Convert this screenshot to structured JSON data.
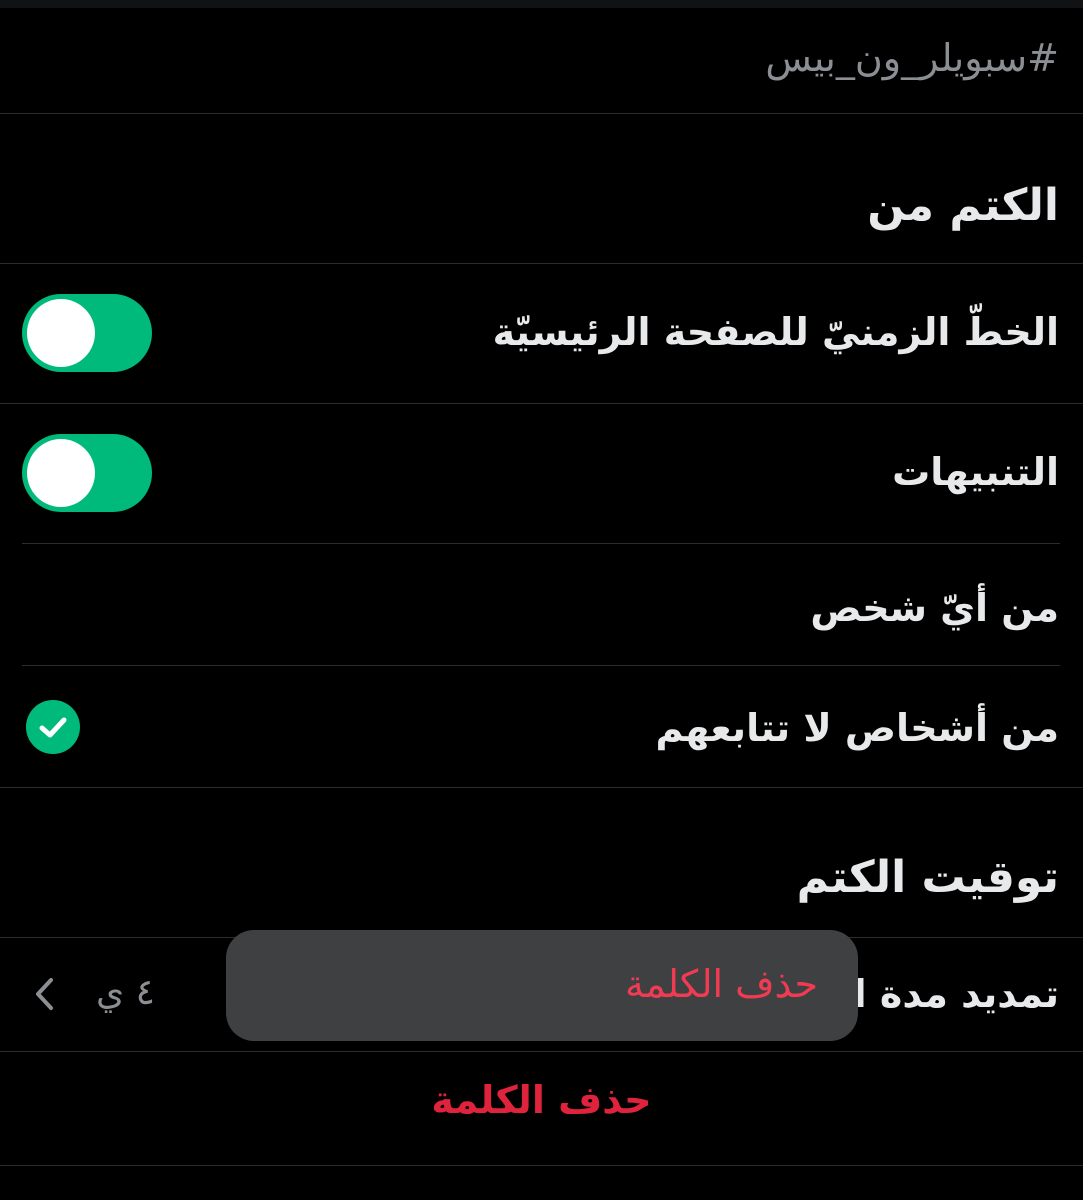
{
  "keyword": "#سبويلر_ون_بيس",
  "mute_from": {
    "title": "الكتم من",
    "home_timeline_label": "الخطّ الزمنيّ للصفحة الرئيسيّة",
    "home_timeline_on": true,
    "notifications_label": "التنبيهات",
    "notifications_on": true,
    "from_anyone_label": "من أيّ شخص",
    "from_non_followed_label": "من أشخاص لا تتابعهم",
    "selected_option": "from_non_followed"
  },
  "mute_timing": {
    "title": "توقيت الكتم",
    "duration_label": "تمديد مدة الكتم",
    "duration_value": "٤ ي"
  },
  "delete_label": "حذف الكلمة",
  "popup": {
    "label": "حذف الكلمة"
  },
  "colors": {
    "accent": "#00ba7c",
    "danger": "#e0233c",
    "background": "#000000"
  }
}
